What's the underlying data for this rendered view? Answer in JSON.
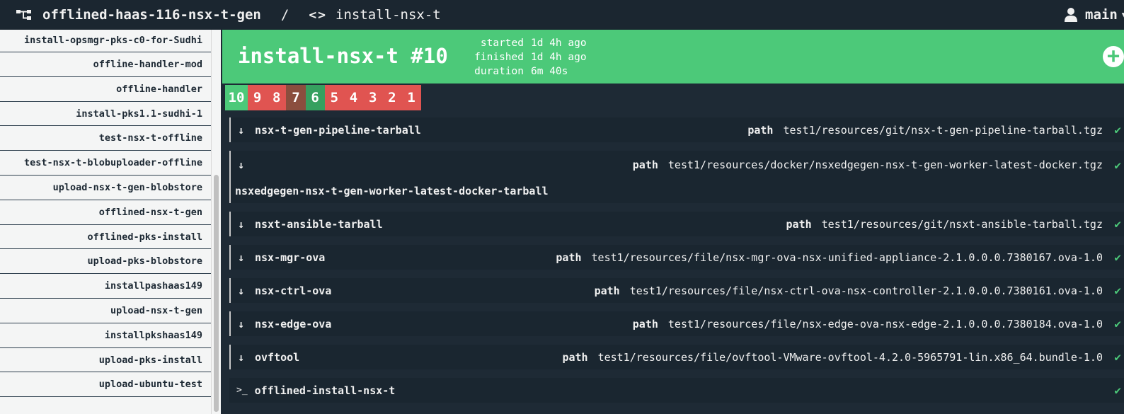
{
  "topbar": {
    "pipeline_name": "offlined-haas-116-nsx-t-gen",
    "separator": "/",
    "job_icon": "<>",
    "job_name": "install-nsx-t",
    "user": "main"
  },
  "sidebar": {
    "items": [
      "install-opsmgr-pks-c0-for-Sudhi",
      "offline-handler-mod",
      "offline-handler",
      "install-pks1.1-sudhi-1",
      "test-nsx-t-offline",
      "test-nsx-t-blobuploader-offline",
      "upload-nsx-t-gen-blobstore",
      "offlined-nsx-t-gen",
      "offlined-pks-install",
      "upload-pks-blobstore",
      "installpashaas149",
      "upload-nsx-t-gen",
      "installpkshaas149",
      "upload-pks-install",
      "upload-ubuntu-test"
    ]
  },
  "build": {
    "title": "install-nsx-t #10",
    "started_label": "started",
    "started_value": "1d 4h ago",
    "finished_label": "finished",
    "finished_value": "1d 4h ago",
    "duration_label": "duration",
    "duration_value": "6m 40s",
    "status_color": "#4cc979"
  },
  "builds": [
    {
      "n": "10",
      "status": "succeeded"
    },
    {
      "n": "9",
      "status": "failed"
    },
    {
      "n": "8",
      "status": "failed"
    },
    {
      "n": "7",
      "status": "errored"
    },
    {
      "n": "6",
      "status": "prev-ok"
    },
    {
      "n": "5",
      "status": "failed"
    },
    {
      "n": "4",
      "status": "failed"
    },
    {
      "n": "3",
      "status": "failed"
    },
    {
      "n": "2",
      "status": "failed"
    },
    {
      "n": "1",
      "status": "failed"
    }
  ],
  "steps": {
    "path_label": "path",
    "check": "✔",
    "arrow": "↓",
    "s0": {
      "name": "nsx-t-gen-pipeline-tarball",
      "path": "test1/resources/git/nsx-t-gen-pipeline-tarball.tgz"
    },
    "s1": {
      "name": "nsxedgegen-nsx-t-gen-worker-latest-docker-tarball",
      "path": "test1/resources/docker/nsxedgegen-nsx-t-gen-worker-latest-docker.tgz"
    },
    "s2": {
      "name": "nsxt-ansible-tarball",
      "path": "test1/resources/git/nsxt-ansible-tarball.tgz"
    },
    "s3": {
      "name": "nsx-mgr-ova",
      "path": "test1/resources/file/nsx-mgr-ova-nsx-unified-appliance-2.1.0.0.0.7380167.ova-1.0"
    },
    "s4": {
      "name": "nsx-ctrl-ova",
      "path": "test1/resources/file/nsx-ctrl-ova-nsx-controller-2.1.0.0.0.7380161.ova-1.0"
    },
    "s5": {
      "name": "nsx-edge-ova",
      "path": "test1/resources/file/nsx-edge-ova-nsx-edge-2.1.0.0.0.7380184.ova-1.0"
    },
    "s6": {
      "name": "ovftool",
      "path": "test1/resources/file/ovftool-VMware-ovftool-4.2.0-5965791-lin.x86_64.bundle-1.0"
    },
    "task": {
      "icon": ">_",
      "name": "offlined-install-nsx-t"
    }
  }
}
